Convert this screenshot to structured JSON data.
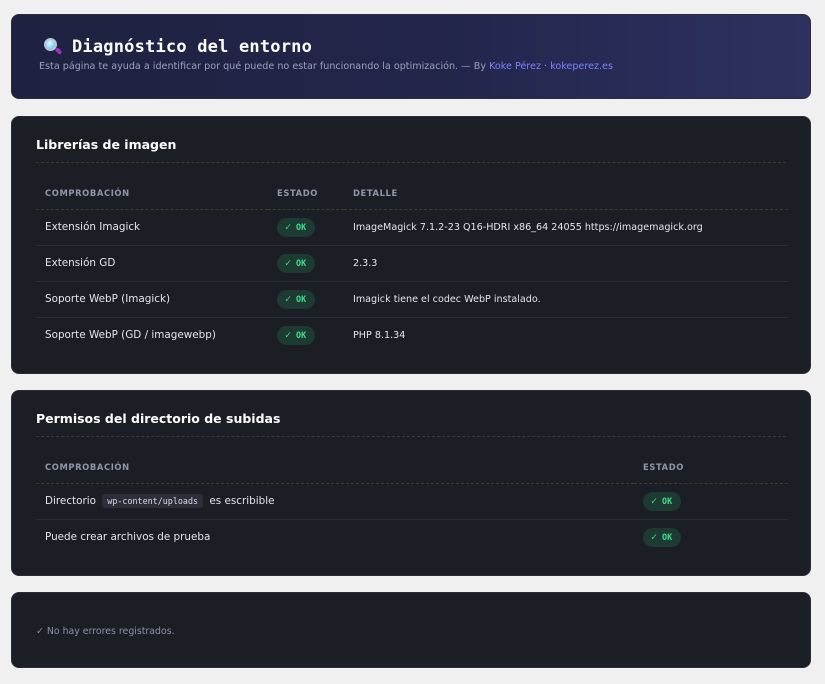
{
  "header": {
    "title": "Diagnóstico del entorno",
    "subtitle_prefix": "Esta página te ayuda a identificar por qué puede no estar funcionando la optimización. — By ",
    "author_link": "Koke Pérez",
    "separator": " · ",
    "site_link": "kokeperez.es",
    "icon": "magnifying-glass-icon"
  },
  "image_libs": {
    "title": "Librerías de imagen",
    "columns": [
      "COMPROBACIÓN",
      "ESTADO",
      "DETALLE"
    ],
    "rows": [
      {
        "check": "Extensión Imagick",
        "status": "OK",
        "detail": "ImageMagick 7.1.2-23 Q16-HDRI x86_64 24055 https://imagemagick.org"
      },
      {
        "check": "Extensión GD",
        "status": "OK",
        "detail": "2.3.3"
      },
      {
        "check": "Soporte WebP (Imagick)",
        "status": "OK",
        "detail": "Imagick tiene el codec WebP instalado."
      },
      {
        "check": "Soporte WebP (GD / imagewebp)",
        "status": "OK",
        "detail": "PHP 8.1.34"
      }
    ]
  },
  "uploads": {
    "title": "Permisos del directorio de subidas",
    "columns": [
      "COMPROBACIÓN",
      "ESTADO"
    ],
    "row1": {
      "prefix": "Directorio",
      "path": "wp-content/uploads",
      "suffix": "es escribible",
      "status": "OK"
    },
    "row2": {
      "check": "Puede crear archivos de prueba",
      "status": "OK"
    }
  },
  "log": {
    "message": "✓ No hay errores registrados."
  },
  "colors": {
    "ok_text": "#3fe08b",
    "ok_bg": "#1d3a33",
    "card_bg": "#1c1e26",
    "link": "#7c83ff"
  },
  "status_icon": "check-icon",
  "check_glyph": "✓"
}
